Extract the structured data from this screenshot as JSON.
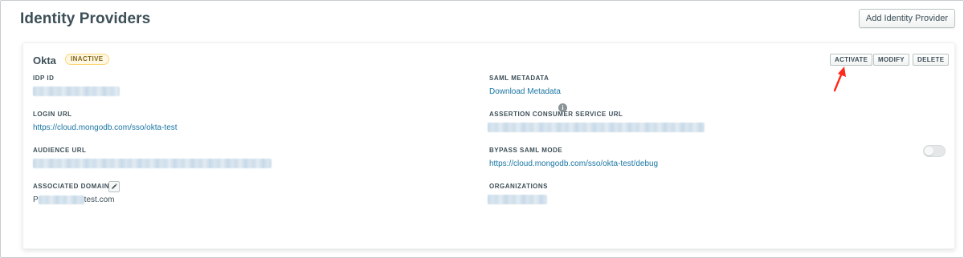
{
  "page": {
    "title": "Identity Providers",
    "add_button": "Add Identity Provider"
  },
  "provider": {
    "name": "Okta",
    "status": "INACTIVE",
    "actions": {
      "activate": "ACTIVATE",
      "modify": "MODIFY",
      "delete": "DELETE"
    },
    "fields": {
      "idp_id": {
        "label": "IDP ID",
        "value": ""
      },
      "login_url": {
        "label": "LOGIN URL",
        "value": "https://cloud.mongodb.com/sso/okta-test"
      },
      "audience_url": {
        "label": "AUDIENCE URL",
        "value": ""
      },
      "associated_domains": {
        "label": "ASSOCIATED DOMAINS",
        "prefix": "P",
        "suffix": "test.com"
      },
      "saml_metadata": {
        "label": "SAML METADATA",
        "value": "Download Metadata"
      },
      "acs_url": {
        "label": "ASSERTION CONSUMER SERVICE URL",
        "value": ""
      },
      "bypass_saml_mode": {
        "label": "BYPASS SAML MODE",
        "value": "https://cloud.mongodb.com/sso/okta-test/debug",
        "enabled": false
      },
      "organizations": {
        "label": "ORGANIZATIONS",
        "value": ""
      }
    }
  },
  "colors": {
    "link": "#1a76a4",
    "badge_bg": "#fef7e3",
    "badge_text": "#86681d",
    "arrow": "#ff2a1a"
  },
  "icons": {
    "info": "info-icon",
    "edit": "pencil-icon",
    "arrow": "red-arrow-icon"
  }
}
